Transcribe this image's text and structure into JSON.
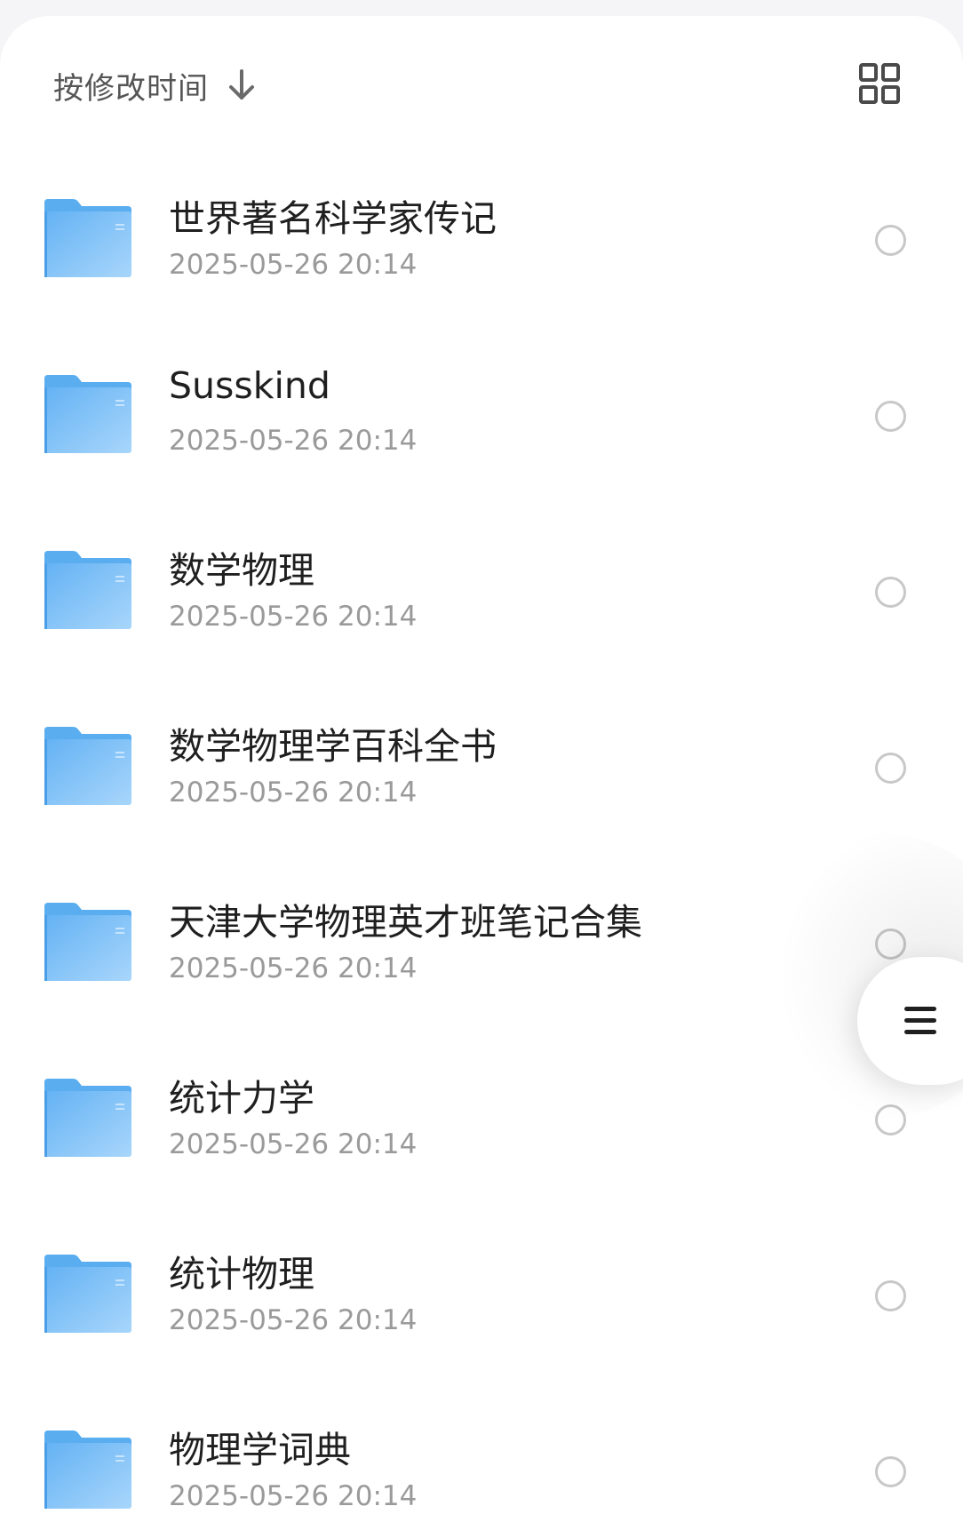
{
  "toolbar": {
    "sort_label": "按修改时间",
    "sort_arrow_icon": "arrow-down-icon",
    "view_toggle_icon": "grid-view-icon"
  },
  "files": [
    {
      "name": "世界著名科学家传记",
      "time": "2025-05-26 20:14"
    },
    {
      "name": "Susskind",
      "time": "2025-05-26 20:14"
    },
    {
      "name": "数学物理",
      "time": "2025-05-26 20:14"
    },
    {
      "name": "数学物理学百科全书",
      "time": "2025-05-26 20:14"
    },
    {
      "name": "天津大学物理英才班笔记合集",
      "time": "2025-05-26 20:14"
    },
    {
      "name": "统计力学",
      "time": "2025-05-26 20:14"
    },
    {
      "name": "统计物理",
      "time": "2025-05-26 20:14"
    },
    {
      "name": "物理学词典",
      "time": "2025-05-26 20:14"
    }
  ],
  "floating_menu": {
    "icon": "menu-icon"
  },
  "colors": {
    "folder_blue": "#7cc0f5",
    "folder_tab": "#5aaef0",
    "text_primary": "#1f1f1f",
    "text_secondary": "#9a9a9a"
  }
}
